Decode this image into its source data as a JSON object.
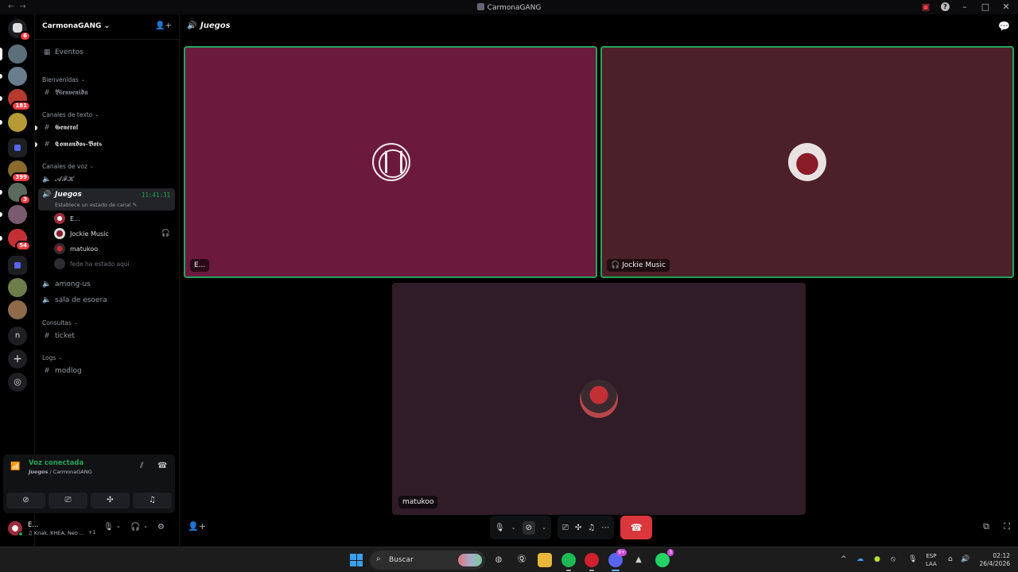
{
  "window": {
    "title": "CarmonaGANG"
  },
  "rail": {
    "badges": {
      "home": "6",
      "server_lol": "181",
      "server_b": "399",
      "server_c": "3",
      "server_d": "54"
    },
    "text_server": "n"
  },
  "sidebar": {
    "server_name": "CarmonaGANG",
    "events": "Eventos",
    "categories": {
      "welcome": "Bienvenidas",
      "text": "Canales de texto",
      "voice": "Canales de voz",
      "consultas": "Consultas",
      "logs": "Logs"
    },
    "channels": {
      "bienvenida": "𝕭𝖎𝖊𝖓𝖛𝖊𝖓𝖎𝖉𝖆",
      "general": "𝕲𝖊𝖓𝖊𝖗𝖆𝖑",
      "comandos": "𝕮𝖔𝖒𝖆𝖓𝖉𝖔𝖘-𝕭𝖔𝖙𝖘",
      "afk": "𝓐𝓕𝓚",
      "juegos": "𝙅𝙪𝙚𝙜𝙤𝙨",
      "among": "among-us",
      "espera": "sala de esoera",
      "ticket": "ticket",
      "modlog": "modlog"
    },
    "juegos_timer": "11:41:31",
    "juegos_status": "Establece un estado de canal",
    "voice_users": [
      "E...",
      "Jockie Music",
      "matukoo",
      "fede ha estado aquí"
    ]
  },
  "voice_panel": {
    "status": "Voz conectada",
    "channel": "𝙅𝙪𝙚𝙜𝙤𝙨",
    "server": " / CarmonaGANG"
  },
  "user": {
    "name": "E...",
    "activity": "♫ Knak, KHEA, Neo ...",
    "extra": "+1"
  },
  "main": {
    "channel_title": "𝙅𝙪𝙚𝙜𝙤𝙨",
    "tiles": [
      "E...",
      "Jockie Music",
      "matukoo"
    ]
  },
  "taskbar": {
    "search": "Buscar",
    "lang_1": "ESP",
    "lang_2": "LAA",
    "time": "02:12",
    "date": "26/4/2026",
    "discord_badge": "9+",
    "whatsapp_badge": "3"
  },
  "colors": {
    "accent_green": "#23a559",
    "danger_red": "#da373c",
    "tile_1": "#6b1a3d",
    "tile_2": "#4c2028",
    "tile_3": "#2f1c26"
  }
}
